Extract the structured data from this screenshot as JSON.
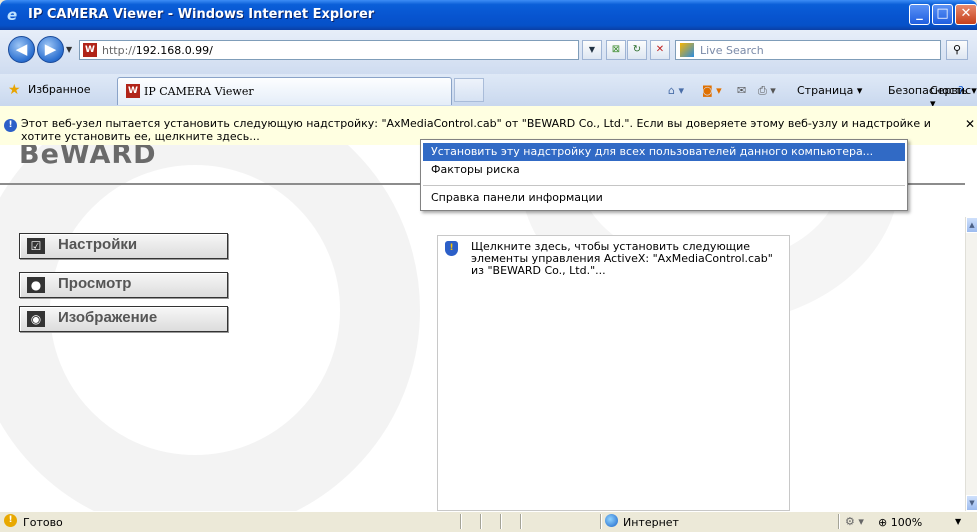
{
  "window": {
    "title": "IP CAMERA Viewer - Windows Internet Explorer"
  },
  "address_bar": {
    "url_prefix": "http://",
    "url_host": "192.168.0.99/"
  },
  "search": {
    "placeholder": "Live Search"
  },
  "favorites": {
    "label": "Избранное"
  },
  "tab": {
    "label": "IP CAMERA Viewer"
  },
  "command_bar": {
    "page": "Страница ▾",
    "security": "Безопасность ▾",
    "tools": "Сервис ▾"
  },
  "info_bar": {
    "text": "Этот веб-узел пытается установить следующую надстройку: \"AxMediaControl.cab\" от \"BEWARD Co., Ltd.\". Если вы доверяете этому веб-узлу и надстройке и хотите установить ее, щелкните здесь..."
  },
  "context_menu": {
    "items": [
      "Установить эту надстройку для всех пользователей данного компьютера...",
      "Факторы риска",
      "Справка панели информации"
    ]
  },
  "page": {
    "logo": "BeWARD",
    "menu": [
      "Настройки",
      "Просмотр",
      "Изображение"
    ],
    "activex_prompt": "Щелкните здесь, чтобы установить следующие элементы управления ActiveX: \"AxMediaControl.cab\" из \"BEWARD Co., Ltd.\"..."
  },
  "status_bar": {
    "status": "Готово",
    "zone": "Интернет",
    "zoom": "100%"
  },
  "colors": {
    "title_bar": "#0754d0",
    "selection": "#316ac5",
    "info_bar": "#ffffe1",
    "close_button": "#c6401c"
  }
}
